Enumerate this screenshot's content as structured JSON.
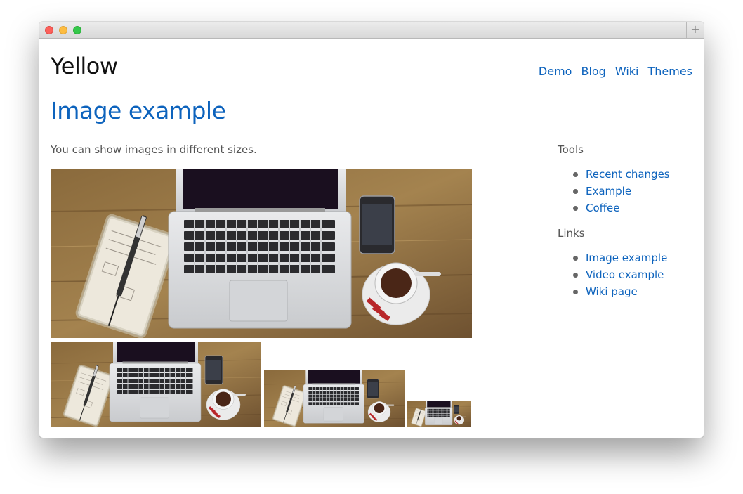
{
  "site": {
    "title": "Yellow"
  },
  "nav": [
    "Demo",
    "Blog",
    "Wiki",
    "Themes"
  ],
  "page": {
    "heading": "Image example",
    "intro": "You can show images in different sizes."
  },
  "images": [
    {
      "size": "large"
    },
    {
      "size": "medium"
    },
    {
      "size": "small"
    },
    {
      "size": "tiny"
    }
  ],
  "sidebar": {
    "tools_heading": "Tools",
    "tools": [
      "Recent changes",
      "Example",
      "Coffee"
    ],
    "links_heading": "Links",
    "links": [
      "Image example",
      "Video example",
      "Wiki page"
    ]
  },
  "colors": {
    "link": "#0d63bd",
    "text": "#555555",
    "title": "#111111"
  }
}
